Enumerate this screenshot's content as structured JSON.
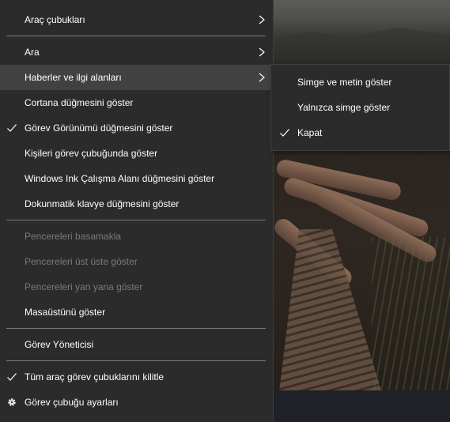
{
  "menu": {
    "items": [
      {
        "label": "Araç çubukları"
      },
      {
        "label": "Ara"
      },
      {
        "label": "Haberler ve ilgi alanları"
      },
      {
        "label": "Cortana düğmesini göster"
      },
      {
        "label": "Görev Görünümü düğmesini göster"
      },
      {
        "label": "Kişileri görev çubuğunda göster"
      },
      {
        "label": "Windows Ink Çalışma Alanı düğmesini göster"
      },
      {
        "label": "Dokunmatik klavye düğmesini göster"
      },
      {
        "label": "Pencereleri basamakla"
      },
      {
        "label": "Pencereleri üst üste göster"
      },
      {
        "label": "Pencereleri yan yana göster"
      },
      {
        "label": "Masaüstünü göster"
      },
      {
        "label": "Görev Yöneticisi"
      },
      {
        "label": "Tüm araç görev çubuklarını kilitle"
      },
      {
        "label": "Görev çubuğu ayarları"
      }
    ]
  },
  "submenu": {
    "items": [
      {
        "label": "Simge ve metin göster"
      },
      {
        "label": "Yalnızca simge göster"
      },
      {
        "label": "Kapat"
      }
    ]
  },
  "icons": {
    "submenu_arrow": "chevron-right-icon",
    "checked": "checkmark-icon",
    "settings": "gear-icon"
  },
  "colors": {
    "menu_bg": "#2b2b2b",
    "highlight_bg": "#414141",
    "text": "#ffffff",
    "disabled_text": "#7a7a7a",
    "separator": "#7a7a7a"
  }
}
